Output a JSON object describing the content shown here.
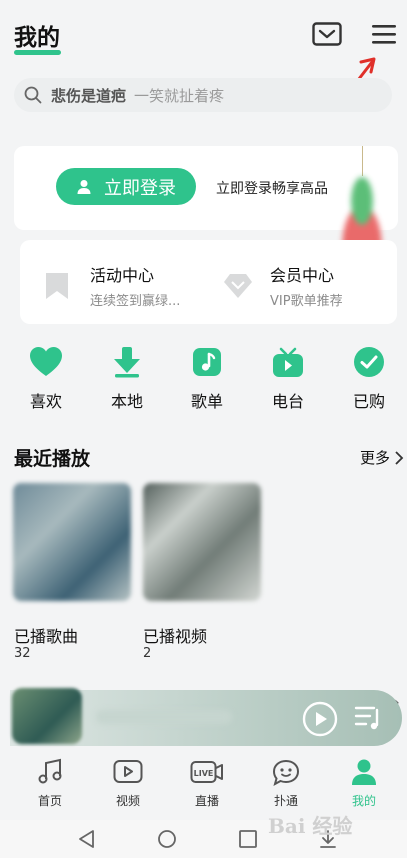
{
  "header": {
    "title": "我的"
  },
  "search": {
    "query": "悲伤是道疤",
    "hint": "一笑就扯着疼"
  },
  "login": {
    "button_label": "立即登录",
    "tip": "立即登录畅享高品"
  },
  "activities": [
    {
      "title": "活动中心",
      "subtitle": "连续签到赢绿..."
    },
    {
      "title": "会员中心",
      "subtitle": "VIP歌单推荐"
    }
  ],
  "quick": [
    {
      "label": "喜欢",
      "icon": "heart-icon"
    },
    {
      "label": "本地",
      "icon": "download-icon"
    },
    {
      "label": "歌单",
      "icon": "playlist-icon"
    },
    {
      "label": "电台",
      "icon": "radio-icon"
    },
    {
      "label": "已购",
      "icon": "check-icon"
    }
  ],
  "recent": {
    "title": "最近播放",
    "more": "更多",
    "items": [
      {
        "label": "已播歌曲",
        "count": "32"
      },
      {
        "label": "已播视频",
        "count": "2"
      }
    ]
  },
  "tabs": [
    {
      "label": "首页",
      "icon": "music-note-icon"
    },
    {
      "label": "视频",
      "icon": "video-icon"
    },
    {
      "label": "直播",
      "icon": "live-icon"
    },
    {
      "label": "扑通",
      "icon": "chat-face-icon"
    },
    {
      "label": "我的",
      "icon": "person-icon",
      "active": true
    }
  ],
  "watermark": "Bai 经验",
  "colors": {
    "accent": "#2fc38c",
    "annotation": "#e0302a"
  }
}
